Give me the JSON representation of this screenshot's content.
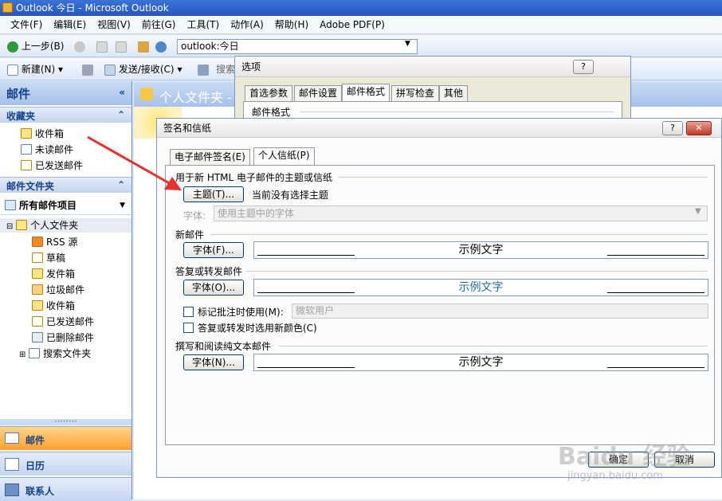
{
  "window": {
    "title": "Outlook 今日 - Microsoft Outlook"
  },
  "menu": [
    "文件(F)",
    "编辑(E)",
    "视图(V)",
    "前往(G)",
    "工具(T)",
    "动作(A)",
    "帮助(H)",
    "Adobe PDF(P)"
  ],
  "toolbar": {
    "back": "上一步(B)",
    "address": "outlook:今日",
    "new": "新建(N)",
    "send_receive": "发送/接收(C)",
    "search": "搜索"
  },
  "nav": {
    "header": "邮件",
    "favorites_title": "收藏夹",
    "favorites": [
      "收件箱",
      "未读邮件",
      "已发送邮件"
    ],
    "folders_title": "邮件文件夹",
    "all_items": "所有邮件项目",
    "personal": "个人文件夹",
    "folders": [
      "RSS 源",
      "草稿",
      "发件箱",
      "垃圾邮件",
      "收件箱",
      "已发送邮件",
      "已删除邮件",
      "搜索文件夹"
    ],
    "buttons": [
      "邮件",
      "日历",
      "联系人"
    ]
  },
  "main": {
    "title": "个人文件夹 -"
  },
  "options": {
    "title": "选项",
    "help": "?",
    "tabs": [
      "首选参数",
      "邮件设置",
      "邮件格式",
      "拼写检查",
      "其他"
    ],
    "section": "邮件格式"
  },
  "sig": {
    "title": "签名和信纸",
    "help": "?",
    "close": "✕",
    "tabs": [
      "电子邮件签名(E)",
      "个人信纸(P)"
    ],
    "g1": "用于新 HTML 电子邮件的主题或信纸",
    "theme_btn": "主题(T)...",
    "theme_status": "当前没有选择主题",
    "font_lbl": "字体:",
    "font_val": "使用主题中的字体",
    "g2": "新邮件",
    "g3": "答复或转发邮件",
    "g4": "撰写和阅读纯文本邮件",
    "font_btn1": "字体(F)...",
    "font_btn2": "字体(O)...",
    "font_btn3": "字体(N)...",
    "sample": "示例文字",
    "mark_lbl": "标记批注时使用(M):",
    "mark_val": "微软用户",
    "color_lbl": "答复或转发时选用新颜色(C)",
    "ok": "确定",
    "cancel": "取消"
  },
  "watermark": {
    "brand": "Baidu 经验",
    "url": "jingyan.baidu.com"
  },
  "colors": {
    "accent": "#ff9f2e",
    "arrow": "#e8312a"
  }
}
